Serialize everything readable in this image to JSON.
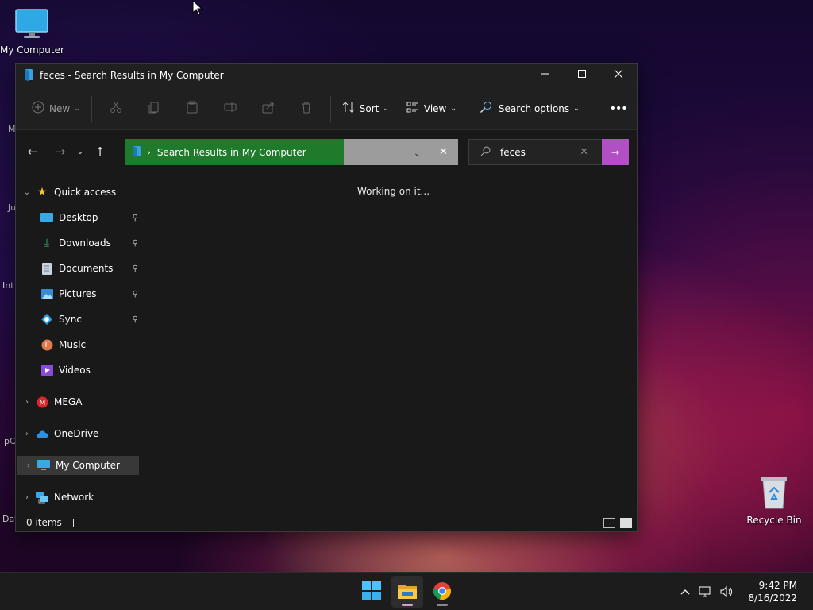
{
  "desktop": {
    "icons": [
      {
        "label": "My Computer",
        "icon": "monitor-icon"
      },
      {
        "label": "Recycle Bin",
        "icon": "recycle-bin-icon"
      }
    ],
    "partial_labels": [
      "M",
      "Ju",
      "Int",
      "pC",
      "Dat"
    ]
  },
  "window": {
    "title": "feces - Search Results in My Computer",
    "controls": {
      "minimize": "minimize-icon",
      "maximize": "maximize-icon",
      "close": "close-icon"
    },
    "toolbar": {
      "new_label": "New",
      "sort_label": "Sort",
      "view_label": "View",
      "search_options_label": "Search options",
      "more_label": "•••"
    },
    "address": {
      "breadcrumb": "Search Results in My Computer"
    },
    "search": {
      "value": "feces"
    },
    "nav": {
      "quick_access": "Quick access",
      "items": [
        {
          "label": "Desktop",
          "pinned": true
        },
        {
          "label": "Downloads",
          "pinned": true
        },
        {
          "label": "Documents",
          "pinned": true
        },
        {
          "label": "Pictures",
          "pinned": true
        },
        {
          "label": "Sync",
          "pinned": true
        },
        {
          "label": "Music",
          "pinned": false
        },
        {
          "label": "Videos",
          "pinned": false
        }
      ],
      "roots": [
        {
          "label": "MEGA"
        },
        {
          "label": "OneDrive"
        },
        {
          "label": "My Computer",
          "selected": true
        },
        {
          "label": "Network"
        }
      ]
    },
    "content": {
      "status_message": "Working on it..."
    },
    "statusbar": {
      "item_count": "0 items"
    }
  },
  "taskbar": {
    "apps": [
      {
        "name": "Start",
        "icon": "windows-start-icon"
      },
      {
        "name": "File Explorer",
        "icon": "file-explorer-icon",
        "active": true
      },
      {
        "name": "Google Chrome",
        "icon": "chrome-icon"
      }
    ],
    "clock": {
      "time": "9:42 PM",
      "date": "8/16/2022"
    }
  },
  "colors": {
    "address_crumb_bg": "#1f7a2c",
    "search_go_bg": "#b34fc4",
    "window_bg": "#191919",
    "taskbar_bg": "#1c1c1c"
  }
}
